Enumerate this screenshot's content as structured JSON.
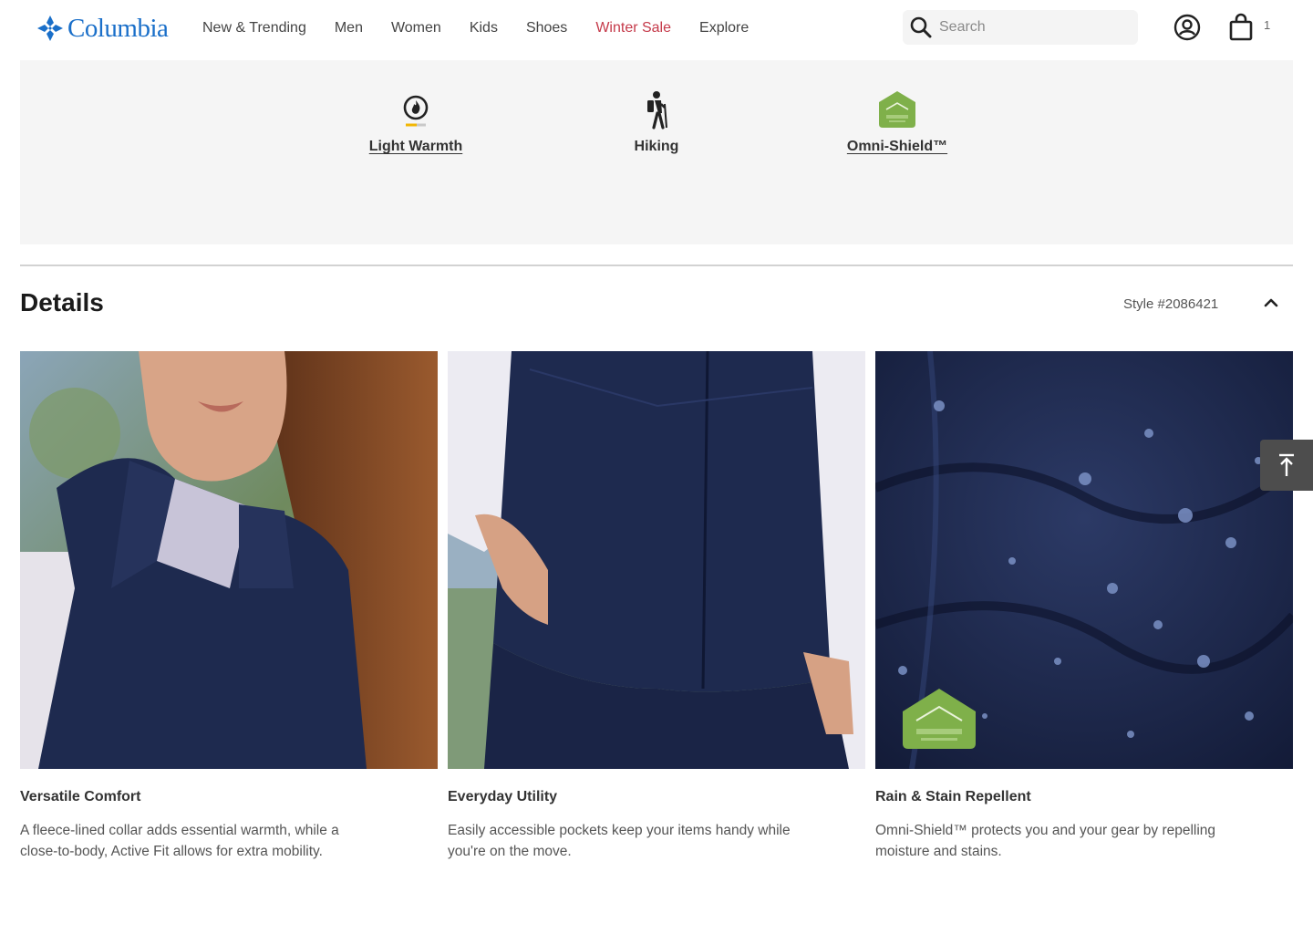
{
  "brand": {
    "name": "Columbia",
    "color": "#1a6fc9"
  },
  "nav": {
    "items": [
      {
        "label": "New & Trending"
      },
      {
        "label": "Men"
      },
      {
        "label": "Women"
      },
      {
        "label": "Kids"
      },
      {
        "label": "Shoes"
      },
      {
        "label": "Winter Sale",
        "color": "#c53a4a"
      },
      {
        "label": "Explore"
      }
    ]
  },
  "search": {
    "placeholder": "Search",
    "icon": "search-icon"
  },
  "header_icons": {
    "account": "account-icon",
    "cart": "shopping-bag-icon",
    "cart_count": "1"
  },
  "benefits": [
    {
      "label": "Light Warmth",
      "icon": "warmth-flame-icon"
    },
    {
      "label": "Hiking",
      "icon": "hiker-icon"
    },
    {
      "label": "Omni-Shield™",
      "icon": "omni-shield-badge-icon"
    }
  ],
  "details": {
    "title": "Details",
    "style_number": "Style #2086421",
    "collapse_icon": "chevron-up-icon",
    "cards": [
      {
        "title": "Versatile Comfort",
        "description": "A fleece-lined collar adds essential warmth, while a close-to-body, Active Fit allows for extra mobility."
      },
      {
        "title": "Everyday Utility",
        "description": "Easily accessible pockets keep your items handy while you're on the move."
      },
      {
        "title": "Rain & Stain Repellent",
        "description": "Omni-Shield™ protects you and your gear by repelling moisture and stains."
      }
    ]
  },
  "scroll_top": {
    "icon": "scroll-to-top-icon"
  },
  "colors": {
    "accent": "#1a6fc9",
    "sale": "#c53a4a",
    "band": "#f5f5f5",
    "vest_navy": "#1e2a4f"
  }
}
